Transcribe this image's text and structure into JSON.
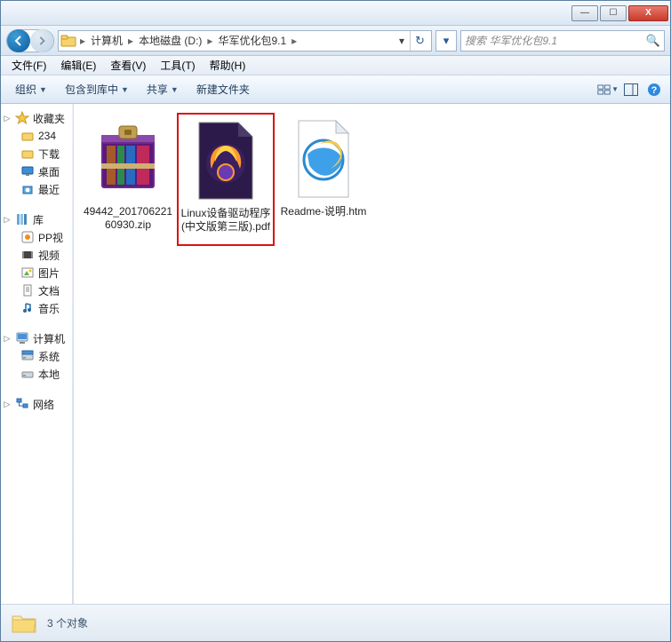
{
  "titlebar": {
    "min": "—",
    "max": "☐",
    "close": "X"
  },
  "breadcrumb": {
    "segs": [
      "计算机",
      "本地磁盘 (D:)",
      "华军优化包9.1"
    ]
  },
  "search": {
    "placeholder": "搜索 华军优化包9.1"
  },
  "menubar": {
    "file": "文件(F)",
    "edit": "编辑(E)",
    "view": "查看(V)",
    "tools": "工具(T)",
    "help": "帮助(H)"
  },
  "toolbar": {
    "organize": "组织",
    "include": "包含到库中",
    "share": "共享",
    "newfolder": "新建文件夹"
  },
  "sidebar": {
    "favorites": {
      "label": "收藏夹",
      "items": [
        "234",
        "下载",
        "桌面",
        "最近"
      ]
    },
    "libraries": {
      "label": "库",
      "items": [
        "PP视",
        "视频",
        "图片",
        "文档",
        "音乐"
      ]
    },
    "computer": {
      "label": "计算机",
      "items": [
        "系统",
        "本地"
      ]
    },
    "network": {
      "label": "网络"
    }
  },
  "files": [
    {
      "name": "49442_20170622160930.zip",
      "type": "zip",
      "highlight": false
    },
    {
      "name": "Linux设备驱动程序(中文版第三版).pdf",
      "type": "pdf",
      "highlight": true
    },
    {
      "name": "Readme-说明.htm",
      "type": "htm",
      "highlight": false
    }
  ],
  "status": {
    "text": "3 个对象"
  }
}
